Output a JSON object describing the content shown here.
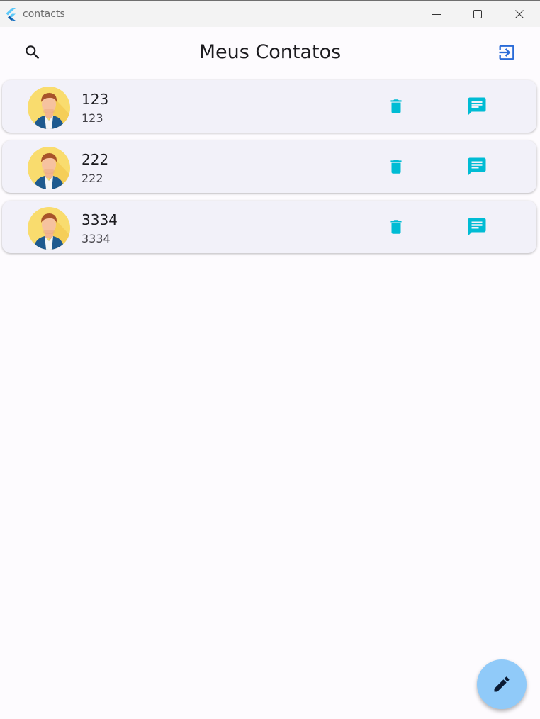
{
  "window": {
    "app_title": "contacts",
    "controls": [
      "minimize-icon",
      "maximize-icon",
      "close-icon"
    ]
  },
  "appbar": {
    "title": "Meus Contatos",
    "search_icon": "search-icon",
    "logout_icon": "login-arrow-icon"
  },
  "contacts": [
    {
      "name": "123",
      "phone": "123",
      "avatar": "avatar-person-icon"
    },
    {
      "name": "222",
      "phone": "222",
      "avatar": "avatar-person-icon"
    },
    {
      "name": "3334",
      "phone": "3334",
      "avatar": "avatar-person-icon"
    }
  ],
  "row_actions": {
    "delete_icon": "delete-icon",
    "message_icon": "message-icon"
  },
  "fab": {
    "icon": "edit-pencil-icon"
  },
  "colors": {
    "accent": "#00bcd4",
    "logout_icon": "#2a6bd8",
    "fab_background": "#90caf9",
    "card_background": "#f2f1f9",
    "page_background": "#fdfbfe",
    "avatar_background": "#f9dc6e"
  }
}
